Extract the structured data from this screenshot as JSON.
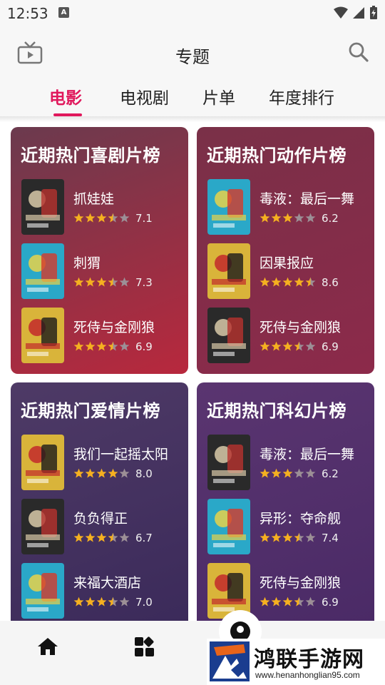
{
  "status_bar": {
    "time": "12:53",
    "notification_letter": "A"
  },
  "header": {
    "title": "专题"
  },
  "tabs": [
    {
      "label": "电影",
      "active": true
    },
    {
      "label": "电视剧",
      "active": false
    },
    {
      "label": "片单",
      "active": false
    },
    {
      "label": "年度排行",
      "active": false
    }
  ],
  "accent_color": "#e0185c",
  "lists": [
    {
      "title": "近期热门喜剧片榜",
      "colors": [
        "#6b3a4e",
        "#b8283d"
      ],
      "movies": [
        {
          "name": "抓娃娃",
          "rating": "7.1",
          "stars": 3.5
        },
        {
          "name": "刺猬",
          "rating": "7.3",
          "stars": 3.5
        },
        {
          "name": "死侍与金刚狼",
          "rating": "6.9",
          "stars": 3.5
        }
      ]
    },
    {
      "title": "近期热门动作片榜",
      "colors": [
        "#7a3048",
        "#8c2a4a"
      ],
      "movies": [
        {
          "name": "毒液：最后一舞",
          "rating": "6.2",
          "stars": 3
        },
        {
          "name": "因果报应",
          "rating": "8.6",
          "stars": 4.5
        },
        {
          "name": "死侍与金刚狼",
          "rating": "6.9",
          "stars": 3.5
        }
      ]
    },
    {
      "title": "近期热门爱情片榜",
      "colors": [
        "#4e3a66",
        "#3b2a5a"
      ],
      "movies": [
        {
          "name": "我们一起摇太阳",
          "rating": "8.0",
          "stars": 4
        },
        {
          "name": "负负得正",
          "rating": "6.7",
          "stars": 3.5
        },
        {
          "name": "来福大酒店",
          "rating": "7.0",
          "stars": 3.5
        }
      ]
    },
    {
      "title": "近期热门科幻片榜",
      "colors": [
        "#5a3570",
        "#4a2a66"
      ],
      "movies": [
        {
          "name": "毒液：最后一舞",
          "rating": "6.2",
          "stars": 3
        },
        {
          "name": "异形：夺命舰",
          "rating": "7.4",
          "stars": 3.5
        },
        {
          "name": "死侍与金刚狼",
          "rating": "6.9",
          "stars": 3.5
        }
      ]
    }
  ],
  "watermark": {
    "title": "鸿联手游网",
    "url": "www.henanhonglian95.com"
  }
}
